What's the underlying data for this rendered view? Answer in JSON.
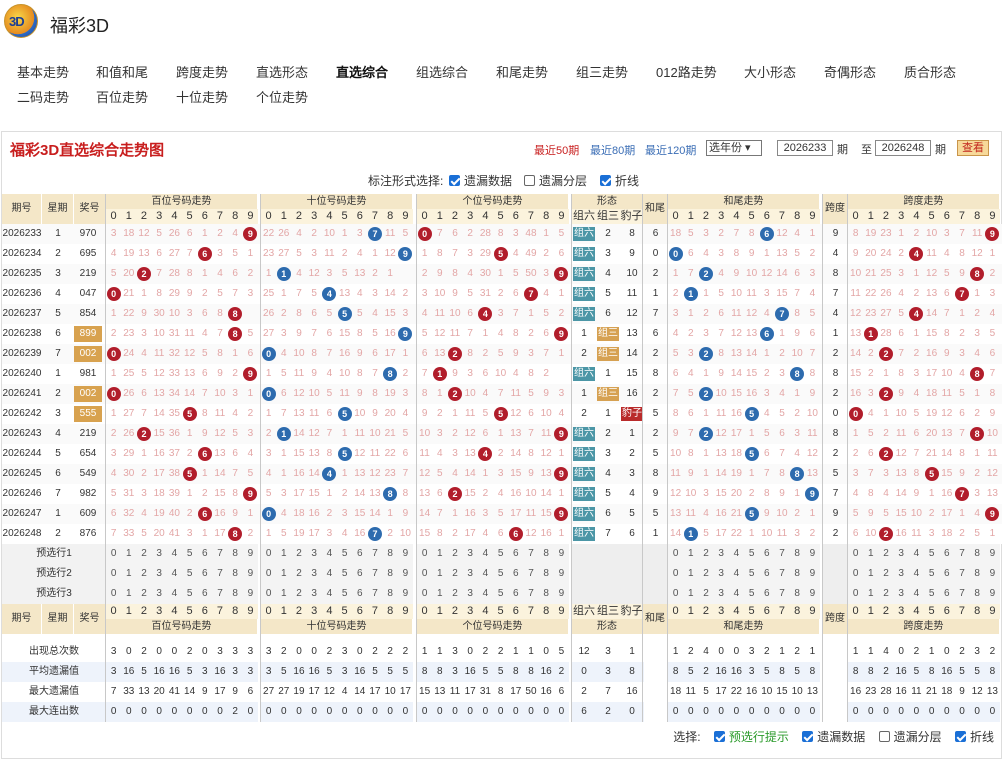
{
  "app": {
    "title": "福彩3D",
    "logo_text": "3D"
  },
  "nav": [
    [
      "基本走势",
      17,
      62
    ],
    [
      "和值和尾",
      96,
      62
    ],
    [
      "跨度走势",
      176,
      62
    ],
    [
      "直选形态",
      256,
      62
    ],
    [
      "直选综合",
      336,
      62
    ],
    [
      "组选综合",
      416,
      62
    ],
    [
      "和尾走势",
      496,
      62
    ],
    [
      "组三走势",
      576,
      62
    ],
    [
      "012路走势",
      656,
      62
    ],
    [
      "大小形态",
      744,
      62
    ],
    [
      "奇偶形态",
      824,
      62
    ],
    [
      "质合形态",
      904,
      62
    ],
    [
      "二码走势",
      17,
      87
    ],
    [
      "百位走势",
      96,
      87
    ],
    [
      "十位走势",
      176,
      87
    ],
    [
      "个位走势",
      256,
      87
    ]
  ],
  "panel": {
    "title": "福彩3D直选综合走势图",
    "recent50": "最近50期",
    "recent80": "最近80期",
    "recent120": "最近120期",
    "year_select": "选年份 ▾",
    "from": "2026233",
    "to": "2026248",
    "qi": "期",
    "zhi": "至",
    "query": "查看"
  },
  "options": {
    "label": "标注形式选择:",
    "miss": "遗漏数据",
    "layer": "遗漏分层",
    "line": "折线"
  },
  "headers": {
    "issue": "期号",
    "week": "星期",
    "prize": "奖号",
    "hundreds": "百位号码走势",
    "tens": "十位号码走势",
    "units": "个位号码走势",
    "shape": "形态",
    "g6": "组六",
    "g3": "组三",
    "bz": "豹子",
    "tail": "和尾",
    "tailtrend": "和尾走势",
    "span": "跨度",
    "spantrend": "跨度走势"
  },
  "rows": [
    {
      "issue": "2026233",
      "week": "1",
      "prize": "970",
      "h": "3 18 12 5 26 6 1 2 4 9",
      "t": "22 26 4 2 10 1 3 7 11 5",
      "u": "0 7 6 2 28 8 3 48 1 5",
      "g6": "组六",
      "g3": "2",
      "bz": "8",
      "tail": "6",
      "w": "18 5 3 2 7 8 6 12 4 1",
      "sp": "9",
      "k": "8 19 23 1 2 10 3 7 11 9",
      "bh": 9,
      "bt": 7,
      "bu": 0,
      "bw": 6,
      "bk": 9,
      "type": "g6"
    },
    {
      "issue": "2026234",
      "week": "2",
      "prize": "695",
      "h": "4 19 13 6 27 7 6 3 5 1",
      "t": "23 27 5 3 11 2 4 1 12 9",
      "u": "1 8 7 3 29 5 4 49 2 6",
      "g6": "组六",
      "g3": "3",
      "bz": "9",
      "tail": "0",
      "w": "0 6 4 3 8 9 1 13 5 2",
      "sp": "4",
      "k": "9 20 24 2 4 11 4 8 12 1",
      "bh": 6,
      "bt": 9,
      "bu": 5,
      "bw": 0,
      "bk": 4,
      "type": "g6"
    },
    {
      "issue": "2026235",
      "week": "3",
      "prize": "219",
      "h": "5 20 2 7 28 8 1 4 6 2",
      "t": "1 6 4 12 3 5 13 2 1",
      "u": "2 9 8 4 30 1 5 50 3 9",
      "g6": "组六",
      "g3": "4",
      "bz": "10",
      "tail": "2",
      "w": "1 7 2 4 9 10 12 14 6 3",
      "sp": "8",
      "k": "10 21 25 3 1 12 5 9 8 2",
      "bh": 2,
      "bt": 1,
      "bu": 9,
      "bw": 2,
      "bk": 8,
      "type": "g6"
    },
    {
      "issue": "2026236",
      "week": "4",
      "prize": "047",
      "h": "0 21 1 8 29 9 2 5 7 3",
      "t": "25 1 7 5 4 13 4 3 14 2",
      "u": "3 10 9 5 31 2 6 7 4 1",
      "g6": "组六",
      "g3": "5",
      "bz": "11",
      "tail": "1",
      "w": "2 1 1 5 10 11 3 15 7 4",
      "sp": "7",
      "k": "11 22 26 4 2 13 6 7 1 3",
      "bh": 0,
      "bt": 4,
      "bu": 7,
      "bw": 1,
      "bk": 7,
      "type": "g6"
    },
    {
      "issue": "2026237",
      "week": "5",
      "prize": "854",
      "h": "1 22 9 30 10 3 6 8 4",
      "t": "26 2 8 6 5 14 5 4 15 3",
      "u": "4 11 10 6 4 3 7 1 5 2",
      "g6": "组六",
      "g3": "6",
      "bz": "12",
      "tail": "7",
      "w": "3 1 2 6 11 12 4 7 8 5",
      "sp": "4",
      "k": "12 23 27 5 4 14 7 1 2 4",
      "bh": 8,
      "bt": 5,
      "bu": 4,
      "bw": 7,
      "bk": 4,
      "type": "g6"
    },
    {
      "issue": "2026238",
      "week": "6",
      "prize": "899",
      "h": "2 23 3 10 31 11 4 7 8 5",
      "t": "27 3 9 7 6 15 8 5 16 9",
      "u": "5 12 11 7 1 4 8 2 6 9",
      "g6": "1",
      "g3": "组三",
      "bz": "13",
      "tail": "6",
      "w": "4 2 3 7 12 13 6 1 9 6",
      "sp": "1",
      "k": "13 1 28 6 1 15 8 2 3 5",
      "bh": 8,
      "bt": 9,
      "bu": 9,
      "bw": 6,
      "bk": 1,
      "type": "g3"
    },
    {
      "issue": "2026239",
      "week": "7",
      "prize": "002",
      "h": "0 24 4 11 32 12 5 8 1 6",
      "t": "0 4 10 8 7 16 9 6 17 1",
      "u": "6 13 2 8 2 5 9 3 7 1",
      "g6": "2",
      "g3": "组三",
      "bz": "14",
      "tail": "2",
      "w": "5 3 2 8 13 14 1 2 10 7",
      "sp": "2",
      "k": "14 2 2 7 2 16 9 3 4 6",
      "bh": 0,
      "bt": 0,
      "bu": 2,
      "bw": 2,
      "bk": 2,
      "type": "g3"
    },
    {
      "issue": "2026240",
      "week": "1",
      "prize": "981",
      "h": "1 25 5 12 33 13 6 9 2 9",
      "t": "1 5 11 9 4 10 8 7 18 2",
      "u": "7 1 9 3 6 10 4 8 2",
      "g6": "组六",
      "g3": "1",
      "bz": "15",
      "tail": "8",
      "w": "6 4 1 9 14 15 2 3 8 8",
      "sp": "8",
      "k": "15 2 1 8 3 17 10 4 8 7",
      "bh": 9,
      "bt": 8,
      "bu": 1,
      "bw": 8,
      "bk": 8,
      "type": "g6"
    },
    {
      "issue": "2026241",
      "week": "2",
      "prize": "002",
      "h": "0 26 6 13 34 14 7 10 3 1",
      "t": "0 6 12 10 5 11 9 8 19 3",
      "u": "8 1 2 10 4 7 11 5 9 3",
      "g6": "1",
      "g3": "组三",
      "bz": "16",
      "tail": "2",
      "w": "7 5 2 10 15 16 3 4 1 9",
      "sp": "2",
      "k": "16 3 2 9 4 18 11 5 1 8",
      "bh": 0,
      "bt": 0,
      "bu": 2,
      "bw": 2,
      "bk": 2,
      "type": "g3"
    },
    {
      "issue": "2026242",
      "week": "3",
      "prize": "555",
      "h": "1 27 7 14 35 5 8 11 4 2",
      "t": "1 7 13 11 6 5 10 9 20 4",
      "u": "9 2 1 11 5 5 12 6 10 4",
      "g6": "2",
      "g3": "1",
      "bz": "豹子",
      "tail": "5",
      "w": "8 6 1 11 16 5 4 5 2 10",
      "sp": "0",
      "k": "0 4 1 10 5 19 12 6 2 9",
      "bh": 5,
      "bt": 5,
      "bu": 5,
      "bw": 5,
      "bk": 0,
      "type": "bz"
    },
    {
      "issue": "2026243",
      "week": "4",
      "prize": "219",
      "h": "2 26 2 15 36 1 9 12 5 3",
      "t": "2 1 14 12 7 1 11 10 21 5",
      "u": "10 3 2 12 6 1 13 7 11 9",
      "g6": "组六",
      "g3": "2",
      "bz": "1",
      "tail": "2",
      "w": "9 7 2 12 17 1 5 6 3 11",
      "sp": "8",
      "k": "1 5 2 11 6 20 13 7 8 10",
      "bh": 2,
      "bt": 1,
      "bu": 9,
      "bw": 2,
      "bk": 8,
      "type": "g6"
    },
    {
      "issue": "2026244",
      "week": "5",
      "prize": "654",
      "h": "3 29 1 16 37 2 6 13 6 4",
      "t": "3 1 15 13 8 5 12 11 22 6",
      "u": "11 4 3 13 4 2 14 8 12 1",
      "g6": "组六",
      "g3": "3",
      "bz": "2",
      "tail": "5",
      "w": "10 8 1 13 18 5 6 7 4 12",
      "sp": "2",
      "k": "2 6 2 12 7 21 14 8 1 11",
      "bh": 6,
      "bt": 5,
      "bu": 4,
      "bw": 5,
      "bk": 2,
      "type": "g6"
    },
    {
      "issue": "2026245",
      "week": "6",
      "prize": "549",
      "h": "4 30 2 17 38 5 1 14 7 5",
      "t": "4 1 16 14 4 1 13 12 23 7",
      "u": "12 5 4 14 1 3 15 9 13 9",
      "g6": "组六",
      "g3": "4",
      "bz": "3",
      "tail": "8",
      "w": "11 9 1 14 19 1 7 8 8 13",
      "sp": "5",
      "k": "3 7 3 13 8 5 15 9 2 12",
      "bh": 5,
      "bt": 4,
      "bu": 9,
      "bw": 8,
      "bk": 5,
      "type": "g6"
    },
    {
      "issue": "2026246",
      "week": "7",
      "prize": "982",
      "h": "5 31 3 18 39 1 2 15 8 9",
      "t": "5 3 17 15 1 2 14 13 8 8",
      "u": "13 6 2 15 2 4 16 10 14 1",
      "g6": "组六",
      "g3": "5",
      "bz": "4",
      "tail": "9",
      "w": "12 10 3 15 20 2 8 9 1 9",
      "sp": "7",
      "k": "4 8 4 14 9 1 16 7 3 13",
      "bh": 9,
      "bt": 8,
      "bu": 2,
      "bw": 9,
      "bk": 7,
      "type": "g6"
    },
    {
      "issue": "2026247",
      "week": "1",
      "prize": "609",
      "h": "6 32 4 19 40 2 6 16 9 1",
      "t": "0 4 18 16 2 3 15 14 1 9",
      "u": "14 7 1 16 3 5 17 11 15 9",
      "g6": "组六",
      "g3": "6",
      "bz": "5",
      "tail": "5",
      "w": "13 11 4 16 21 5 9 10 2 1",
      "sp": "9",
      "k": "5 9 5 15 10 2 17 1 4 9",
      "bh": 6,
      "bt": 0,
      "bu": 9,
      "bw": 5,
      "bk": 9,
      "type": "g6"
    },
    {
      "issue": "2026248",
      "week": "2",
      "prize": "876",
      "h": "7 33 5 20 41 3 1 17 8 2",
      "t": "1 5 19 17 3 4 16 7 2 10",
      "u": "15 8 2 17 4 6 6 12 16 1",
      "g6": "组六",
      "g3": "7",
      "bz": "6",
      "tail": "1",
      "w": "14 1 5 17 22 1 10 11 3 2",
      "sp": "2",
      "k": "6 10 2 16 11 3 18 2 5 1",
      "bh": 8,
      "bt": 7,
      "bu": 6,
      "bw": 1,
      "bk": 2,
      "type": "g6"
    }
  ],
  "pre": [
    "预选行1",
    "预选行2",
    "预选行3"
  ],
  "digits": "0 1 2 3 4 5 6 7 8 9",
  "stats": [
    {
      "label": "出现总次数",
      "h": "3 0 2 0 0 2 0 3 3 3",
      "t": "3 2 0 0 2 3 0 2 2 2",
      "u": "1 1 3 0 2 2 1 1 0 5",
      "f": "12 3 1",
      "w": "1 2 4 0 0 3 2 1 2 1",
      "k": "1 1 4 0 2 1 0 2 3 2"
    },
    {
      "label": "平均遗漏值",
      "h": "3 16 5 16 16 5 3 16 3 3",
      "t": "3 5 16 16 5 3 16 5 5 5",
      "u": "8 8 3 16 5 5 8 8 16 2",
      "f": "0 3 8",
      "w": "8 5 2 16 16 3 5 8 5 8",
      "k": "8 8 2 16 5 8 16 5 5 8"
    },
    {
      "label": "最大遗漏值",
      "h": "7 33 13 20 41 14 9 17 9 6",
      "t": "27 27 19 17 12 4 14 17 10 17",
      "u": "15 13 11 17 31 8 17 50 16 6",
      "f": "2 7 16",
      "w": "18 11 5 17 22 16 10 15 10 13",
      "k": "16 23 28 16 11 21 18 9 12 13"
    },
    {
      "label": "最大连出数",
      "h": "0 0 0 0 0 0 0 0 2 0",
      "t": "0 0 0 0 0 0 0 0 0 0",
      "u": "0 0 0 0 0 0 0 0 0 0",
      "f": "6 2 0",
      "w": "0 0 0 0 0 0 0 0 0 0",
      "k": "0 0 0 0 0 0 0 0 0 0"
    }
  ],
  "footer": {
    "label": "选择:",
    "hint": "预选行提示",
    "miss": "遗漏数据",
    "layer": "遗漏分层",
    "line": "折线"
  }
}
